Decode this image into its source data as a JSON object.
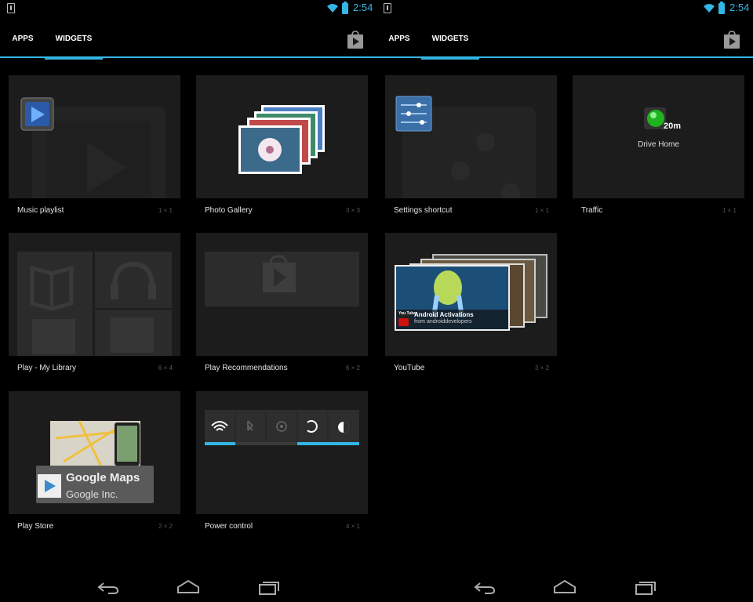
{
  "status": {
    "time": "2:54"
  },
  "tabs": {
    "apps": "APPS",
    "widgets": "WIDGETS"
  },
  "widgets_left": [
    {
      "name": "Music playlist",
      "dims": "1 × 1"
    },
    {
      "name": "Photo Gallery",
      "dims": "3 × 3"
    },
    {
      "name": "Play - My Library",
      "dims": "6 × 4"
    },
    {
      "name": "Play Recommendations",
      "dims": "6 × 2"
    },
    {
      "name": "Play Store",
      "dims": "2 × 2"
    },
    {
      "name": "Power control",
      "dims": "4 × 1"
    }
  ],
  "widgets_right": [
    {
      "name": "Settings shortcut",
      "dims": "1 × 1"
    },
    {
      "name": "Traffic",
      "dims": "1 × 1"
    },
    {
      "name": "YouTube",
      "dims": "3 × 2"
    }
  ],
  "previews": {
    "traffic": {
      "eta": "20m",
      "destination": "Drive Home"
    },
    "play_store": {
      "app_title": "Google Maps",
      "app_developer": "Google Inc."
    },
    "youtube": {
      "video_title": "Android Activations",
      "channel": "from androiddevelopers",
      "logo": "You Tube"
    }
  },
  "icons": {
    "accent": "#33b5e5"
  }
}
